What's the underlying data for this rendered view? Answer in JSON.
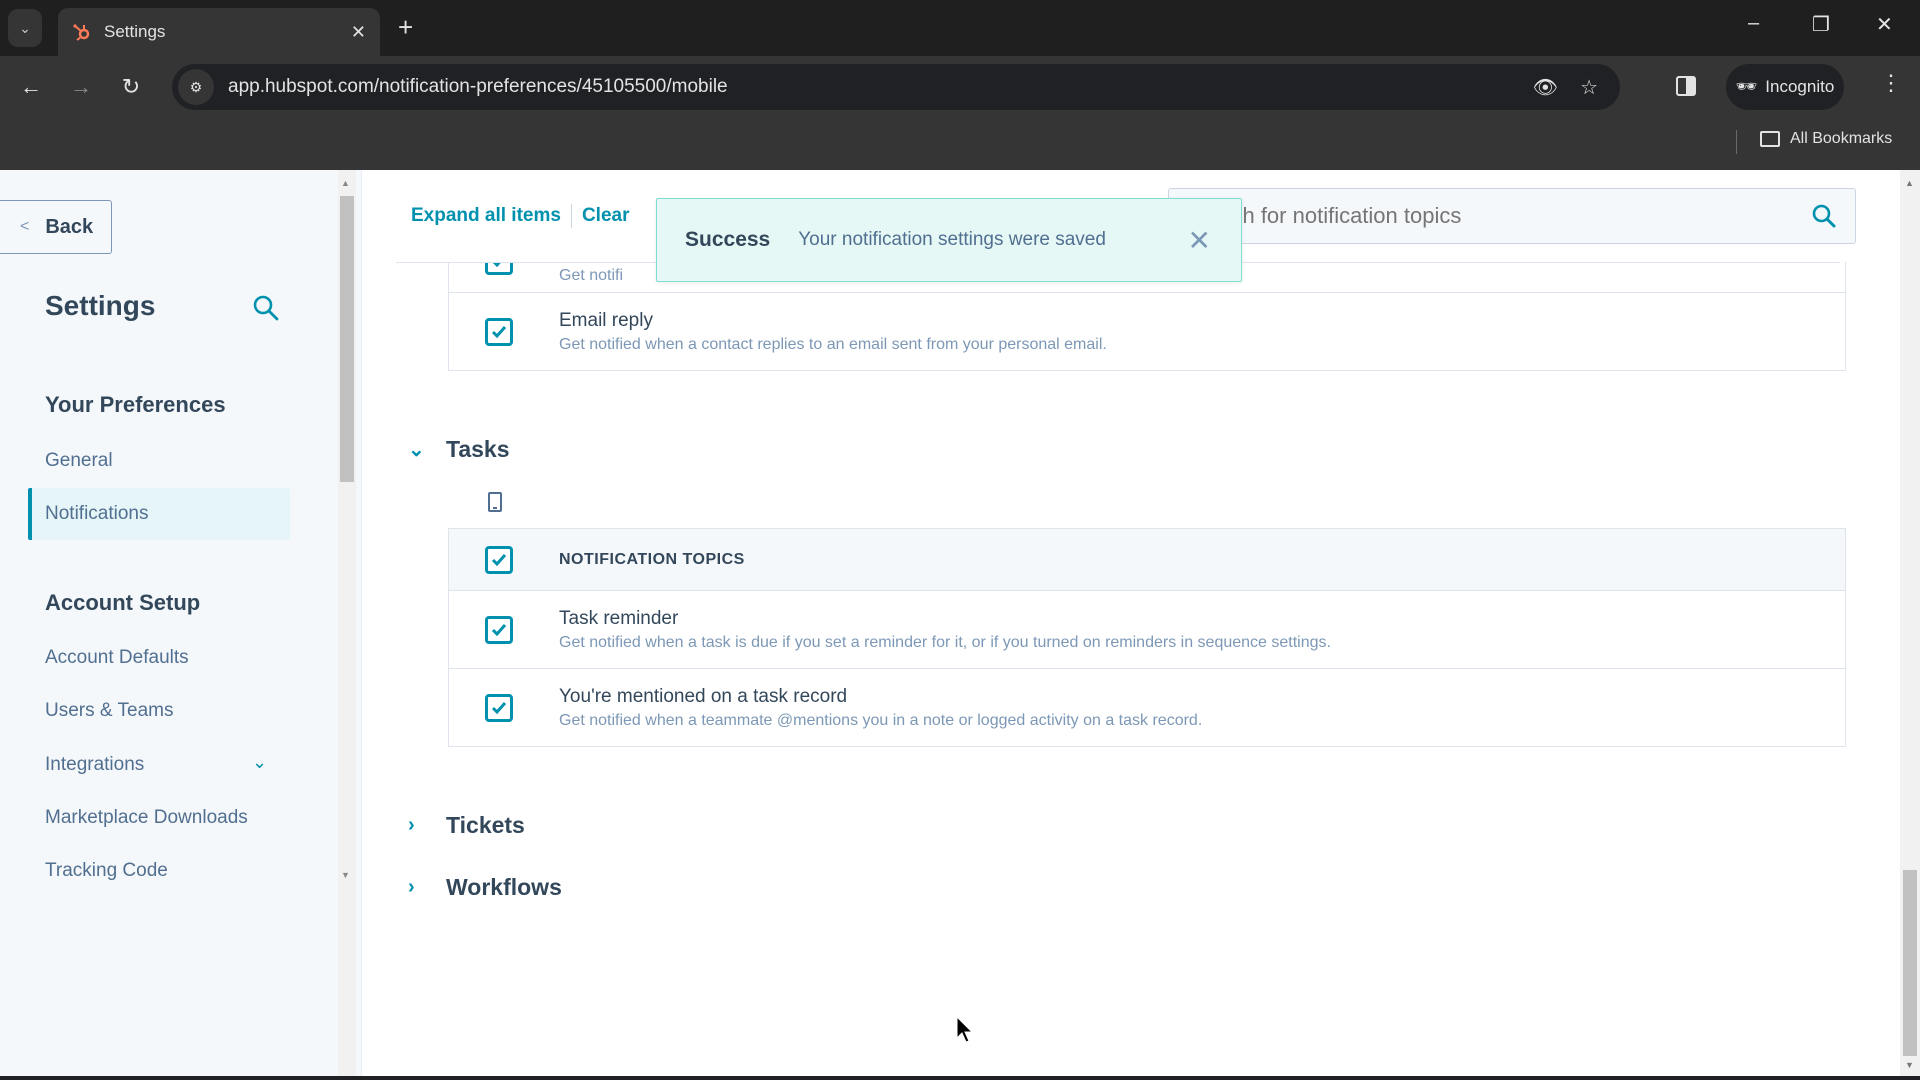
{
  "browser": {
    "tab_title": "Settings",
    "url": "app.hubspot.com/notification-preferences/45105500/mobile",
    "profile_label": "Incognito",
    "bookmarks_label": "All Bookmarks",
    "brand_color": "#ff7a59"
  },
  "sidebar": {
    "back_label": "Back",
    "title": "Settings",
    "sections": [
      {
        "title": "Your Preferences",
        "items": [
          {
            "label": "General",
            "active": false
          },
          {
            "label": "Notifications",
            "active": true
          }
        ]
      },
      {
        "title": "Account Setup",
        "items": [
          {
            "label": "Account Defaults"
          },
          {
            "label": "Users & Teams"
          },
          {
            "label": "Integrations",
            "expandable": true
          },
          {
            "label": "Marketplace Downloads"
          },
          {
            "label": "Tracking Code"
          }
        ]
      }
    ]
  },
  "main": {
    "expand_all_label": "Expand all items",
    "clear_label": "Clear",
    "search_placeholder": "Search for notification topics",
    "search_visible_text": "h for notification topics",
    "toast": {
      "title": "Success",
      "message": "Your notification settings were saved"
    },
    "partial_rows": [
      {
        "label": "",
        "desc": "Get notifi",
        "checked": true
      },
      {
        "label": "Email reply",
        "desc": "Get notified when a contact replies to an email sent from your personal email.",
        "checked": true
      }
    ],
    "groups": [
      {
        "title": "Tasks",
        "expanded": true,
        "channel_icon": "mobile-phone-icon",
        "header_label": "NOTIFICATION TOPICS",
        "header_checked": true,
        "topics": [
          {
            "label": "Task reminder",
            "desc": "Get notified when a task is due if you set a reminder for it, or if you turned on reminders in sequence settings.",
            "checked": true
          },
          {
            "label": "You're mentioned on a task record",
            "desc": "Get notified when a teammate @mentions you in a note or logged activity on a task record.",
            "checked": true
          }
        ]
      },
      {
        "title": "Tickets",
        "expanded": false
      },
      {
        "title": "Workflows",
        "expanded": false
      }
    ],
    "accent_color": "#0091ae"
  }
}
